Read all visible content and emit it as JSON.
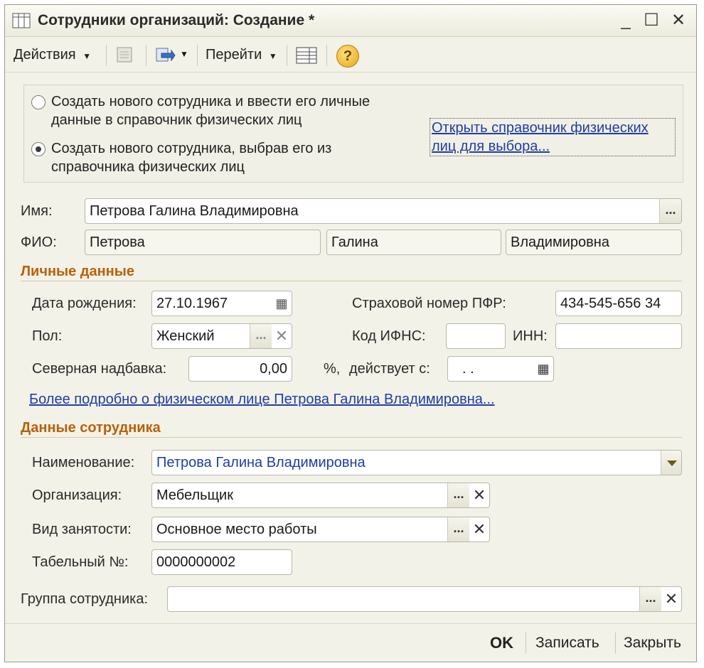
{
  "window": {
    "title": "Сотрудники организаций: Создание *",
    "controls": {
      "minimize": "_",
      "maximize": "☐",
      "close": "✕"
    }
  },
  "toolbar": {
    "actions": "Действия",
    "goto": "Перейти",
    "help": "?"
  },
  "mode": {
    "option_new": "Создать нового сотрудника и ввести его личные данные в справочник физических лиц",
    "option_select": "Создать нового сотрудника, выбрав его из справочника физических лиц",
    "selected": "option_select",
    "open_link": "Открыть справочник физических лиц для выбора..."
  },
  "person": {
    "name_label": "Имя:",
    "name_value": "Петрова Галина Владимировна",
    "fio_label": "ФИО:",
    "last_name": "Петрова",
    "first_name": "Галина",
    "middle_name": "Владимировна"
  },
  "personal": {
    "section_title": "Личные данные",
    "birth_label": "Дата рождения:",
    "birth_value": "27.10.1967",
    "pfr_label": "Страховой номер ПФР:",
    "pfr_value": "434-545-656 34",
    "gender_label": "Пол:",
    "gender_value": "Женский",
    "ifns_label": "Код ИФНС:",
    "ifns_value": "",
    "inn_label": "ИНН:",
    "inn_value": "",
    "north_label": "Северная надбавка:",
    "north_value": "0,00",
    "percent_label": "%,",
    "effective_label": "действует с:",
    "effective_value": ". .",
    "more_link": "Более подробно о физическом лице Петрова Галина Владимировна..."
  },
  "employee": {
    "section_title": "Данные сотрудника",
    "name_label": "Наименование:",
    "name_value": "Петрова Галина Владимировна",
    "org_label": "Организация:",
    "org_value": "Мебельщик",
    "employment_label": "Вид занятости:",
    "employment_value": "Основное место работы",
    "tab_label": "Табельный №:",
    "tab_value": "0000000002",
    "group_label": "Группа сотрудника:",
    "group_value": ""
  },
  "footer": {
    "ok": "OK",
    "save": "Записать",
    "close": "Закрыть"
  },
  "colors": {
    "section": "#b8620b",
    "link": "#1f3ea3",
    "window_bg": "#f3f2e8"
  }
}
